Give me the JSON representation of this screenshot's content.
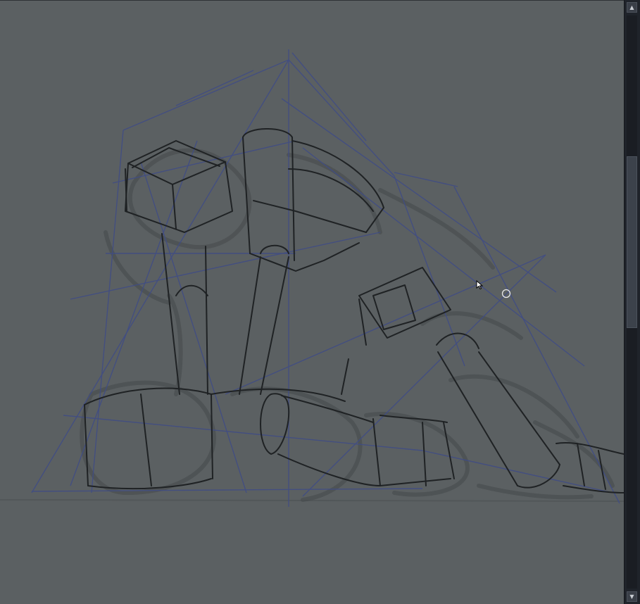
{
  "canvas": {
    "name": "sketch-canvas",
    "background_color": "#5b6062",
    "perspective_guide_color": "#3f4c86",
    "ink_color": "#1f2224",
    "underdrawing_color": "#45494b"
  },
  "cursor": {
    "icon": "arrow-pointer-icon",
    "brush_icon": "circle-brush-cursor-icon"
  },
  "scrollbar": {
    "up_icon": "chevron-up-icon",
    "down_icon": "chevron-down-icon",
    "up_glyph": "▲",
    "down_glyph": "▼"
  }
}
